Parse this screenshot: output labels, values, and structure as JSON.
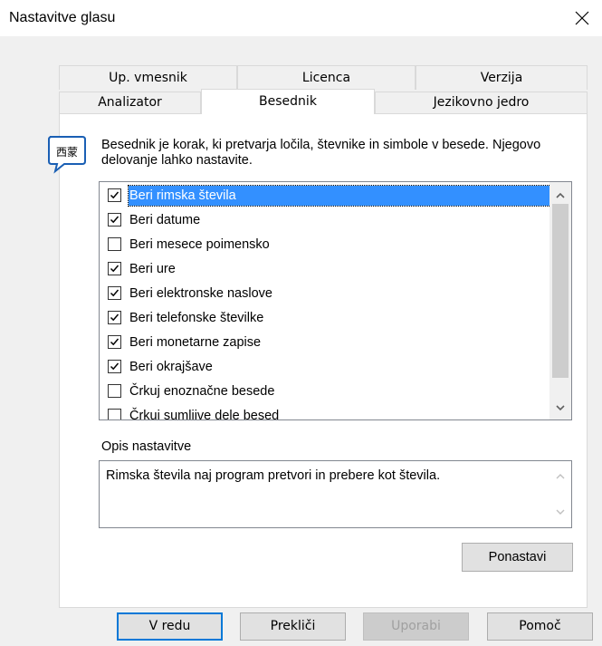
{
  "window": {
    "title": "Nastavitve glasu"
  },
  "tabs": {
    "top_row": [
      "Up. vmesnik",
      "Licenca",
      "Verzija"
    ],
    "bottom_row": [
      "Analizator",
      "Besednik",
      "Jezikovno jedro"
    ],
    "active": "Besednik"
  },
  "description": "Besednik je korak, ki pretvarja ločila, števnike in simbole v besede. Njegovo delovanje lahko nastavite.",
  "options": [
    {
      "label": "Beri rimska števila",
      "checked": true,
      "selected": true
    },
    {
      "label": "Beri datume",
      "checked": true,
      "selected": false
    },
    {
      "label": "Beri mesece poimensko",
      "checked": false,
      "selected": false
    },
    {
      "label": "Beri ure",
      "checked": true,
      "selected": false
    },
    {
      "label": "Beri elektronske naslove",
      "checked": true,
      "selected": false
    },
    {
      "label": "Beri telefonske številke",
      "checked": true,
      "selected": false
    },
    {
      "label": "Beri monetarne zapise",
      "checked": true,
      "selected": false
    },
    {
      "label": "Beri okrajšave",
      "checked": true,
      "selected": false
    },
    {
      "label": "Črkuj enoznačne besede",
      "checked": false,
      "selected": false
    },
    {
      "label": "Črkuj sumljive dele besed",
      "checked": false,
      "selected": false
    }
  ],
  "opis": {
    "label": "Opis nastavitve",
    "text": "Rimska števila naj program pretvori in prebere kot števila."
  },
  "buttons": {
    "reset": "Ponastavi",
    "ok": "V redu",
    "cancel": "Prekliči",
    "apply": "Uporabi",
    "help": "Pomoč"
  },
  "colors": {
    "selection": "#3390ff",
    "default_button_border": "#0078d7",
    "dialog_bg": "#f0f0f0"
  },
  "icons": {
    "close": "close-icon",
    "info": "info-icon"
  }
}
